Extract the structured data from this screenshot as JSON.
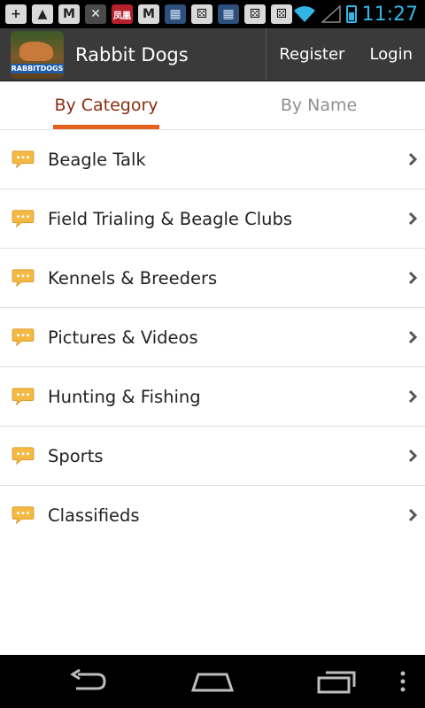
{
  "status_bar": {
    "time": "11:27",
    "notification_icons": [
      "plus-box-icon",
      "image-icon",
      "gmail-icon",
      "tools-icon",
      "news-icon",
      "gmail-icon",
      "film-icon",
      "dice-icon",
      "film-icon",
      "dice-icon",
      "dice-icon"
    ],
    "news_icon_text": "凤凰"
  },
  "action_bar": {
    "title": "Rabbit Dogs",
    "logo_text": "RABBITDOGS",
    "register_label": "Register",
    "login_label": "Login"
  },
  "tabs": [
    {
      "label": "By Category",
      "active": true
    },
    {
      "label": "By Name",
      "active": false
    }
  ],
  "forums": [
    {
      "label": "Beagle Talk"
    },
    {
      "label": "Field Trialing & Beagle Clubs"
    },
    {
      "label": "Kennels & Breeders"
    },
    {
      "label": "Pictures & Videos"
    },
    {
      "label": "Hunting & Fishing"
    },
    {
      "label": "Sports"
    },
    {
      "label": "Classifieds"
    }
  ],
  "colors": {
    "accent": "#e4601c",
    "active_tab_text": "#8a2e12",
    "status_time": "#33b5e5",
    "action_bar": "#3a3a3a",
    "bubble": "#f4b943"
  }
}
